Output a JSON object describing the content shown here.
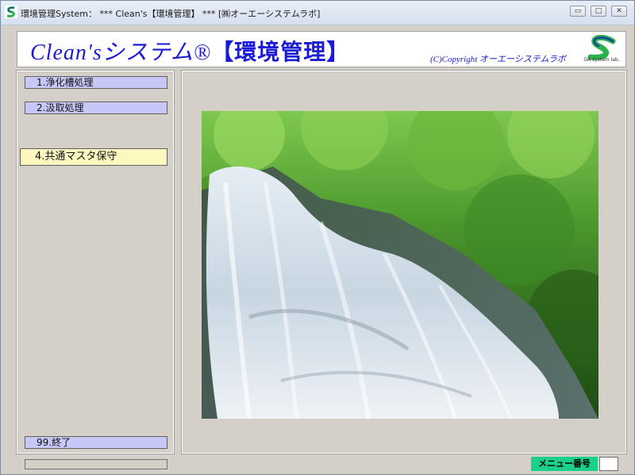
{
  "window": {
    "title": "環境管理System：  *** Clean's【環境管理】 *** [㈱オーエーシステムラボ]",
    "minimize_glyph": "▭",
    "maximize_glyph": "□",
    "close_glyph": "✕"
  },
  "header": {
    "title_main": "Clean'sシステム®",
    "title_bracket": "【環境管理】",
    "copyright": "(C)Copyright オーエーシステムラボ",
    "logo_text": "OA system lab.",
    "logo_color_green": "#2bb24c",
    "logo_color_blue": "#1a3ea8"
  },
  "menu": {
    "items": [
      {
        "label": "1.浄化槽処理"
      },
      {
        "label": "2.汲取処理"
      },
      {
        "label": "4.共通マスタ保守"
      },
      {
        "label": "99.終了"
      }
    ]
  },
  "status": {
    "menu_number_label": "メニュー番号",
    "menu_number_value": ""
  },
  "colors": {
    "menu_button": "#c8c8f8",
    "menu_button_active": "#fcf8c0",
    "title_blue": "#1a1ad8",
    "menu_number_bg": "#1bd08a"
  }
}
